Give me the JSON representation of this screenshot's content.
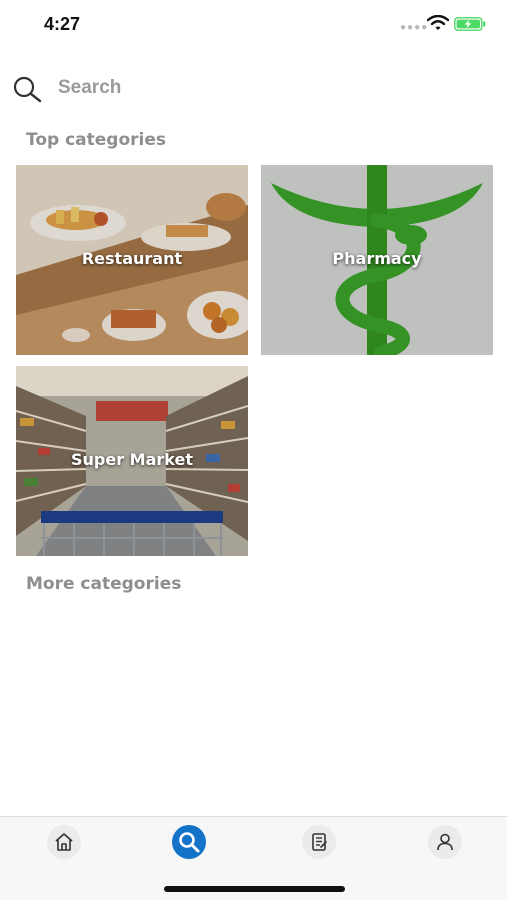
{
  "status_bar": {
    "time": "4:27",
    "signal_icon": "signal-dots",
    "wifi_icon": "wifi-icon",
    "battery_icon": "battery-charging-icon",
    "battery_color": "#4cd964"
  },
  "search": {
    "placeholder": "Search",
    "icon": "search-icon"
  },
  "sections": {
    "top_title": "Top categories",
    "more_title": "More categories"
  },
  "categories": [
    {
      "label": "Restaurant",
      "image": "food-photo"
    },
    {
      "label": "Pharmacy",
      "image": "caduceus-photo",
      "accent": "#3aa02a"
    },
    {
      "label": "Super Market",
      "image": "supermarket-aisle-photo"
    }
  ],
  "bottom_nav": {
    "items": [
      {
        "name": "home",
        "icon": "home-icon"
      },
      {
        "name": "search",
        "icon": "search-icon",
        "active": true
      },
      {
        "name": "orders",
        "icon": "receipt-icon"
      },
      {
        "name": "profile",
        "icon": "user-icon"
      }
    ],
    "active_color": "#1273c9"
  }
}
